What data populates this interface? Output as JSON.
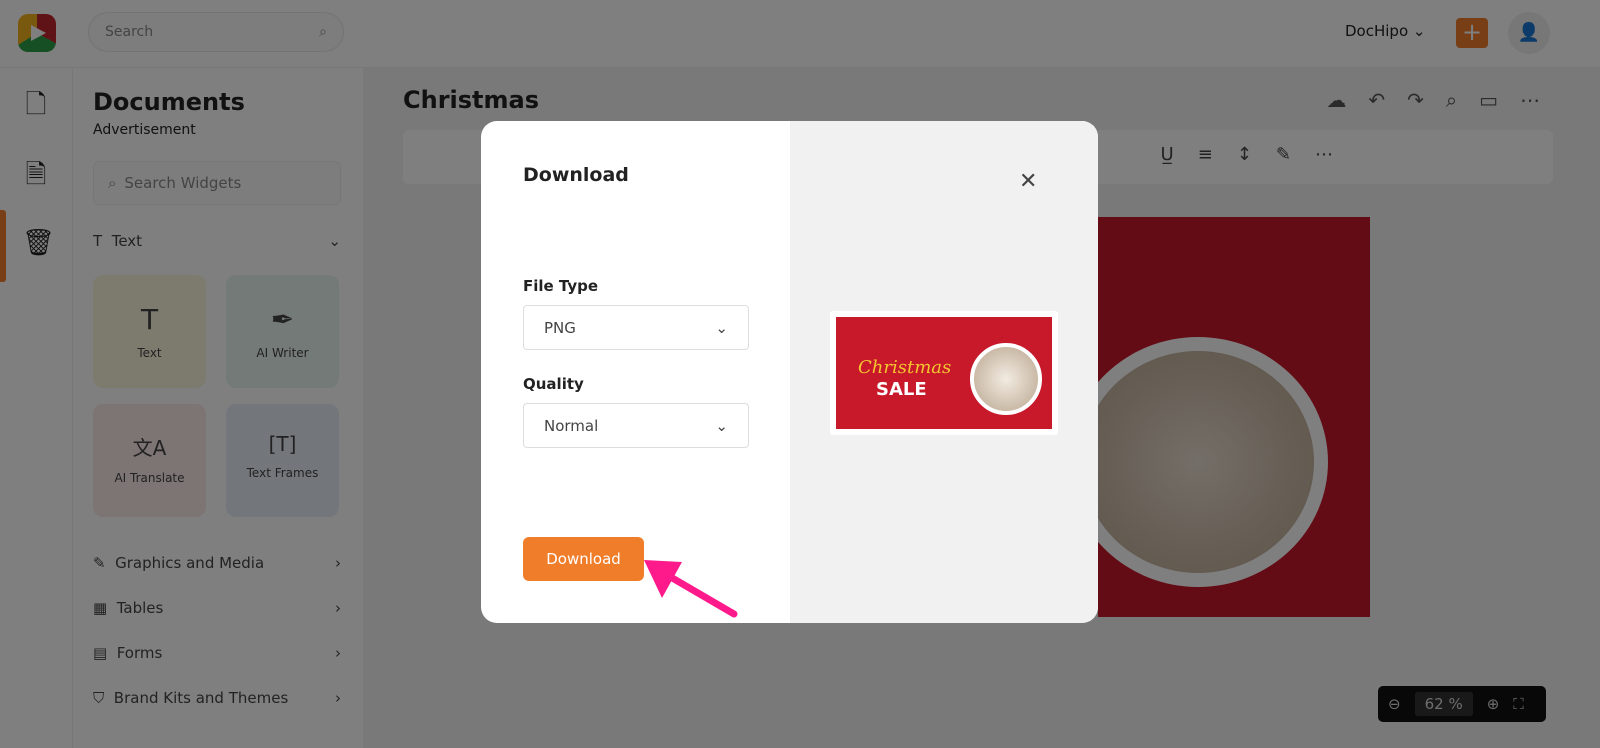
{
  "header": {
    "search_placeholder": "Search",
    "account": "DocHipo",
    "plus": "+"
  },
  "sidebar": {
    "title": "Documents",
    "subtitle": "Advertisement",
    "search_placeholder": "Search Widgets",
    "text_section": "Text",
    "tiles": [
      {
        "label": "Text",
        "icon": "T"
      },
      {
        "label": "AI Writer",
        "icon": "✒"
      },
      {
        "label": "AI Translate",
        "icon": "文A"
      },
      {
        "label": "Text Frames",
        "icon": "[T]"
      }
    ],
    "sections": [
      "Graphics and Media",
      "Tables",
      "Forms",
      "Brand Kits and Themes"
    ]
  },
  "editor": {
    "title": "Christmas",
    "zoom": "62",
    "zoom_unit": "%"
  },
  "modal": {
    "title": "Download",
    "file_type_label": "File Type",
    "file_type": "PNG",
    "quality_label": "Quality",
    "quality": "Normal",
    "download": "Download",
    "preview": {
      "headline": "Christmas",
      "sub": "SALE"
    }
  },
  "colors": {
    "accent": "#f07d2a",
    "arrow": "#ff1a8c",
    "canvas_red": "#c8192a"
  }
}
